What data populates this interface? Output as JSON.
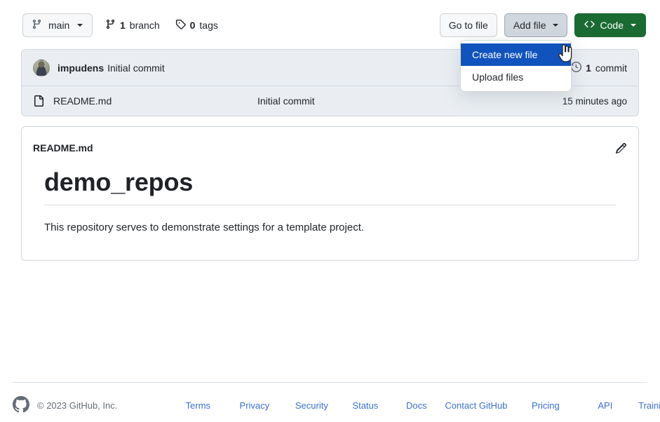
{
  "toolbar": {
    "branch_label": "main",
    "branch_icon": "git-branch-icon",
    "stats": [
      {
        "count": "1",
        "label": "branch",
        "icon": "git-branch-icon",
        "name": "branches-stat"
      },
      {
        "count": "0",
        "label": "tags",
        "icon": "tag-icon",
        "name": "tags-stat"
      }
    ],
    "go_to_file_label": "Go to file",
    "add_file_label": "Add file",
    "code_label": "Code",
    "code_icon": "code-brackets-icon",
    "code_button_color": "#1a6b32"
  },
  "add_file_menu": {
    "open": true,
    "highlight_color": "#1053bd",
    "items": [
      {
        "label": "Create new file",
        "active": true
      },
      {
        "label": "Upload files",
        "active": false
      }
    ]
  },
  "cursor": {
    "icon": "pointer-hand-cursor"
  },
  "commit_bar": {
    "author": "impudens",
    "message": "Initial commit",
    "commit_count": "1",
    "commit_count_suffix": "commit",
    "history_icon": "history-clock-icon",
    "avatar_icon": "user-avatar"
  },
  "files": {
    "rows": [
      {
        "icon": "file-icon",
        "name": "README.md",
        "commit_message": "Initial commit",
        "time": "15 minutes ago"
      }
    ]
  },
  "readme": {
    "title": "README.md",
    "edit_icon": "pencil-edit-icon",
    "heading": "demo_repos",
    "paragraph": "This repository serves to demonstrate settings for a template project."
  },
  "footer": {
    "logo_icon": "github-octocat-icon",
    "copyright": "© 2023 GitHub, Inc.",
    "links": [
      {
        "label": "Terms"
      },
      {
        "label": "Privacy"
      },
      {
        "label": "Security"
      },
      {
        "label": "Status"
      },
      {
        "label": "Docs"
      },
      {
        "label": "Contact GitHub"
      },
      {
        "label": "Pricing"
      },
      {
        "label": "API"
      },
      {
        "label": "Training"
      }
    ],
    "link_color": "#3b6fd4"
  }
}
